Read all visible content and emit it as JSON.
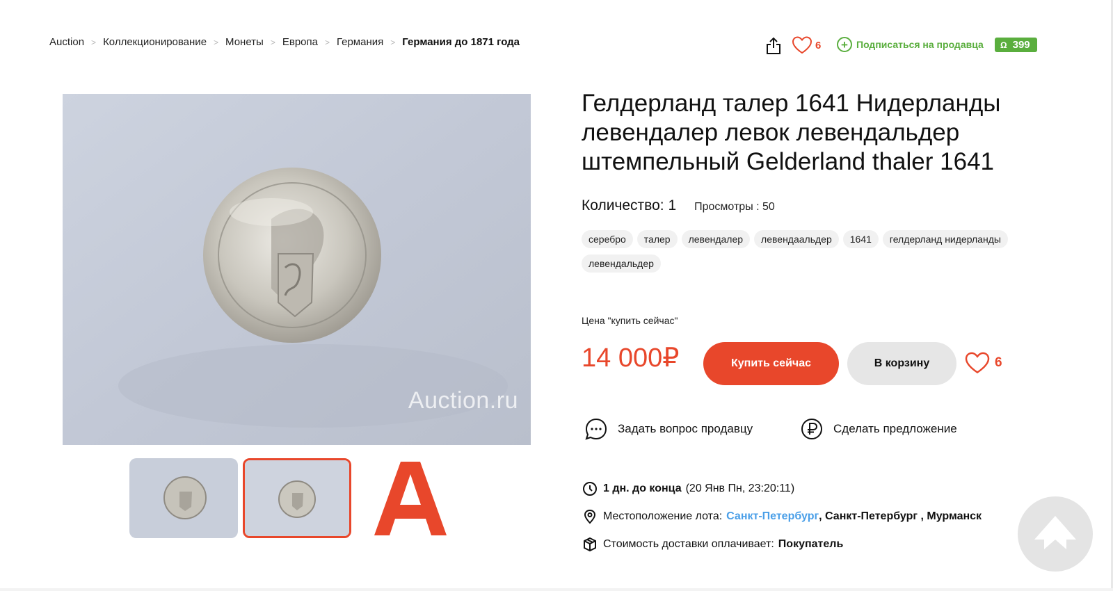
{
  "breadcrumb": {
    "items": [
      "Auction",
      "Коллекционирование",
      "Монеты",
      "Европа",
      "Германия",
      "Германия до 1871 года"
    ],
    "separator": ">"
  },
  "header_actions": {
    "share_icon": "share-icon",
    "favorites_count": "6",
    "subscribe_label": "Подписаться на продавца",
    "seller_rating": "399"
  },
  "gallery": {
    "watermark": "Auction.ru",
    "thumbnails": [
      "coin-thumbnail-1",
      "coin-thumbnail-2"
    ],
    "logo_letter": "A"
  },
  "product": {
    "title": "Гелдерланд талер 1641 Нидерланды левендалер левок левендальдер штемпельный Gelderland thaler 1641",
    "quantity": "Количество: 1",
    "views": "Просмотры : 50",
    "tags": [
      "серебро",
      "талер",
      "левендалер",
      "левендаальдер",
      "1641",
      "гелдерланд нидерланды",
      "левендальдер"
    ]
  },
  "purchase": {
    "price_label": "Цена \"купить сейчас\"",
    "price": "14 000₽",
    "buy_now_label": "Купить сейчас",
    "add_to_cart_label": "В корзину",
    "favorites_count": "6"
  },
  "actions": {
    "ask_seller": "Задать вопрос продавцу",
    "make_offer": "Сделать предложение"
  },
  "info": {
    "time_left": "1 дн. до конца",
    "end_date": "(20 Янв Пн, 23:20:11)",
    "location_label": "Местоположение лота:",
    "location_city_link": "Санкт-Петербург",
    "location_rest": ", Санкт-Петербург , Мурманск",
    "shipping_label": "Стоимость доставки оплачивает:",
    "shipping_payer": "Покупатель"
  },
  "colors": {
    "accent": "#e8472b",
    "green": "#5aae3e",
    "link": "#4a9fe8"
  }
}
